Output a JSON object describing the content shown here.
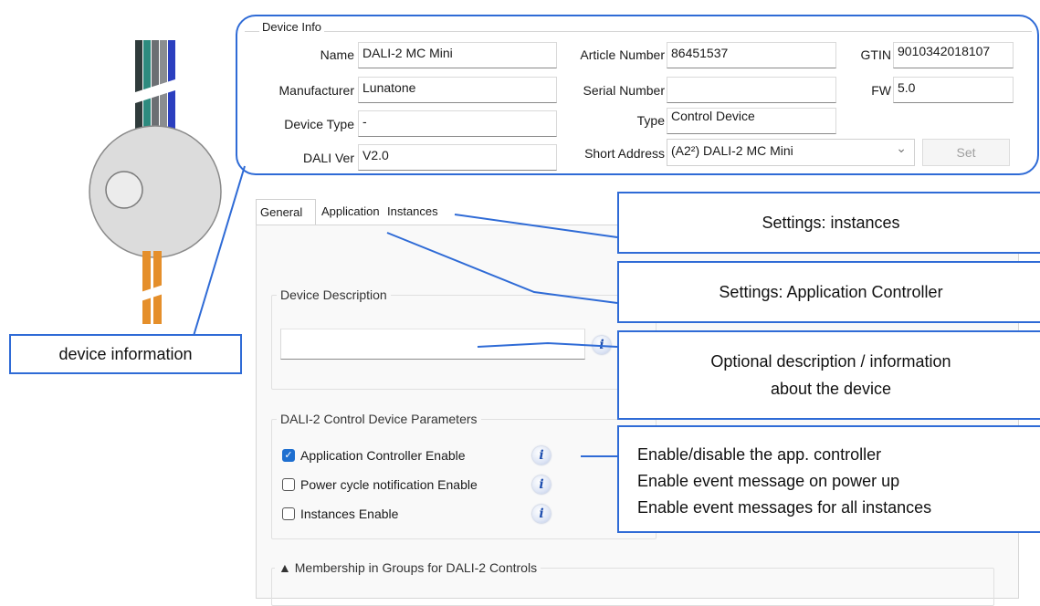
{
  "device_info": {
    "legend": "Device Info",
    "name_label": "Name",
    "name_value": "DALI-2 MC Mini",
    "article_label": "Article Number",
    "article_value": "86451537",
    "gtin_label": "GTIN",
    "gtin_value": "9010342018107",
    "manufacturer_label": "Manufacturer",
    "manufacturer_value": "Lunatone",
    "serial_label": "Serial Number",
    "serial_value": "",
    "fw_label": "FW",
    "fw_value": "5.0",
    "device_type_label": "Device Type",
    "device_type_value": "-",
    "type_label": "Type",
    "type_value": "Control Device",
    "dali_ver_label": "DALI Ver",
    "dali_ver_value": "V2.0",
    "short_address_label": "Short Address",
    "short_address_value": "(A2²) DALI-2 MC Mini",
    "set_button": "Set"
  },
  "tabs": [
    {
      "label": "General",
      "active": true
    },
    {
      "label": "Application",
      "active": false
    },
    {
      "label": "Instances",
      "active": false
    }
  ],
  "general": {
    "device_description_title": "Device Description",
    "device_description_value": "",
    "params_title": "DALI-2 Control Device Parameters",
    "params": [
      {
        "label": "Application Controller Enable",
        "checked": true
      },
      {
        "label": "Power cycle notification Enable",
        "checked": false
      },
      {
        "label": "Instances Enable",
        "checked": false
      }
    ],
    "membership_title": "▲ Membership in Groups for DALI-2 Controls"
  },
  "callouts": {
    "device_information": "device information",
    "instances": "Settings: instances",
    "application": "Settings: Application Controller",
    "description_line1": "Optional description / information",
    "description_line2": "about the device",
    "enable_line1": "Enable/disable  the app. controller",
    "enable_line2": "Enable event message on power up",
    "enable_line3": "Enable event messages for all instances"
  },
  "icons": {
    "info": "i",
    "checkmark": "✓",
    "chevron": "⌄"
  },
  "colors": {
    "callout_border": "#2f6bd6",
    "checkbox_on": "#1e6fd0"
  }
}
